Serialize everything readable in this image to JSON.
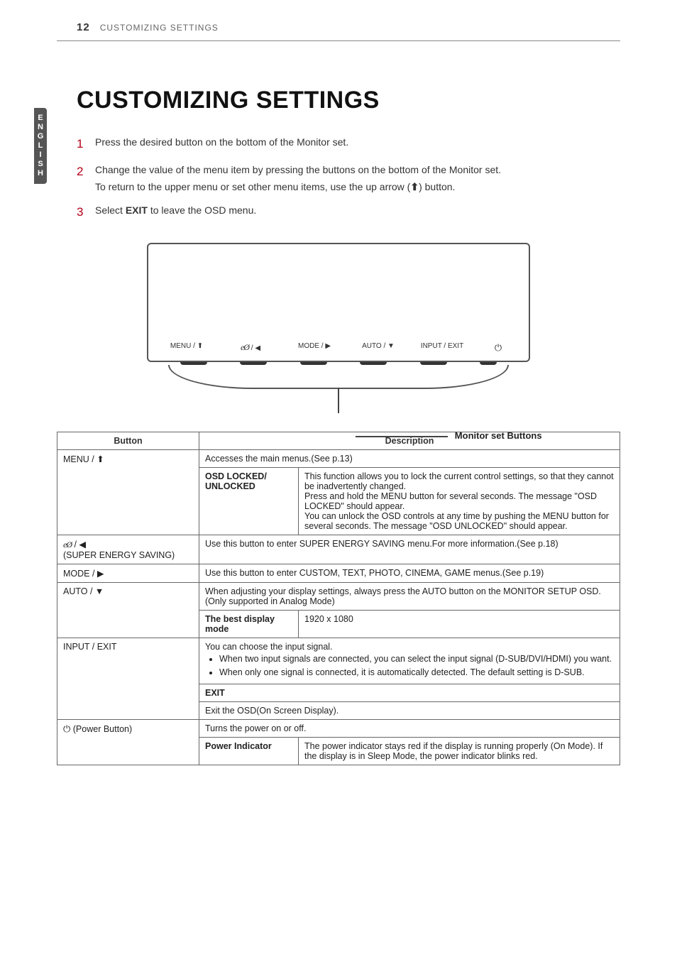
{
  "sideTab": "ENGLISH",
  "header": {
    "pageNum": "12",
    "section": "CUSTOMIZING SETTINGS"
  },
  "title": "CUSTOMIZING SETTINGS",
  "steps": {
    "s1": {
      "num": "1",
      "text": "Press the desired button on the bottom of the Monitor set."
    },
    "s2": {
      "num": "2",
      "line1": "Change the value of the menu item by pressing the buttons on the bottom of the Monitor set.",
      "line2a": "To return to the upper menu or set other menu items, use the up arrow (",
      "line2b": ") button."
    },
    "s3": {
      "num": "3",
      "before": "Select ",
      "bold": "EXIT",
      "after": " to leave the OSD menu."
    }
  },
  "diagram": {
    "buttons": {
      "menu": "MENU / ",
      "eco": " / ◀",
      "mode": "MODE / ▶",
      "auto": "AUTO / ▼",
      "input": "INPUT / EXIT"
    },
    "callout": "Monitor set Buttons"
  },
  "table": {
    "head": {
      "c1": "Button",
      "c2": "Description"
    },
    "r1": {
      "btn": "MENU / ",
      "desc1": "Accesses the main menus.(See p.13)",
      "sub": "OSD LOCKED/ UNLOCKED",
      "desc2": "This function allows you to lock the current control settings, so that they cannot be inadvertently changed.\nPress and hold the MENU button for several seconds. The message \"OSD LOCKED\" should appear.\nYou can unlock the OSD controls at any time by pushing the MENU button for several seconds. The message \"OSD UNLOCKED\" should appear."
    },
    "r2": {
      "btn_l2": "(SUPER ENERGY SAVING)",
      "btn_suffix": " / ◀",
      "desc": "Use this button to enter SUPER ENERGY SAVING menu.For more information.(See p.18)"
    },
    "r3": {
      "btn": "MODE / ▶",
      "desc": "Use this button to enter CUSTOM, TEXT, PHOTO, CINEMA, GAME menus.(See p.19)"
    },
    "r4": {
      "btn": "AUTO / ▼",
      "desc1": "When adjusting your display settings, always press the AUTO button on the MONITOR SETUP OSD. (Only supported in Analog Mode)",
      "sub": "The best display mode",
      "val": "1920 x 1080"
    },
    "r5": {
      "btn": "INPUT / EXIT",
      "intro": "You can choose the input signal.",
      "li1": "When two input signals are connected, you can select the input signal (D-SUB/DVI/HDMI) you want.",
      "li2": "When only one signal is connected, it is automatically detected. The default setting is D-SUB.",
      "sub": "EXIT",
      "desc2": "Exit the OSD(On Screen Display)."
    },
    "r6": {
      "btn": " (Power Button)",
      "desc1": "Turns the power on or off.",
      "sub": "Power Indicator",
      "desc2": "The power indicator stays red if the display is running properly (On Mode). If the display is in Sleep Mode, the power indicator blinks red."
    }
  }
}
